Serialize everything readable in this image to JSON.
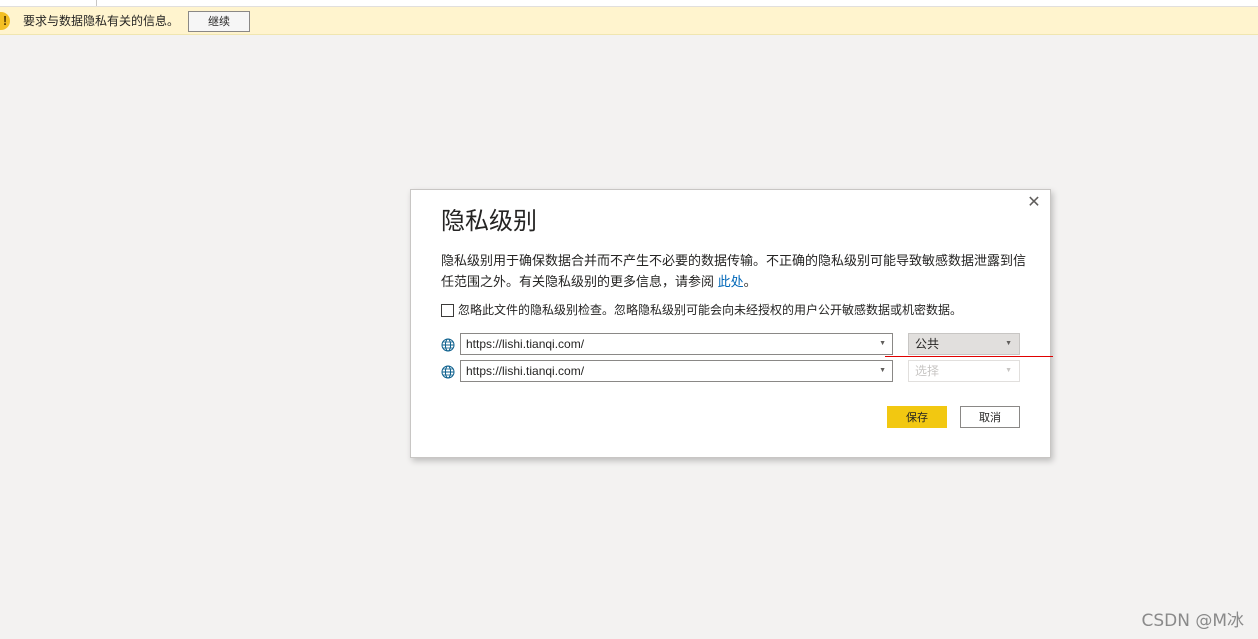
{
  "banner": {
    "icon": "warning-icon",
    "icon_glyph": "!",
    "message": "要求与数据隐私有关的信息。",
    "continue_label": "继续"
  },
  "dialog": {
    "title": "隐私级别",
    "close_glyph": "✕",
    "description": "隐私级别用于确保数据合并而不产生不必要的数据传输。不正确的隐私级别可能导致敏感数据泄露到信任范围之外。有关隐私级别的更多信息，请参阅",
    "link_text": "此处",
    "description_end": "。",
    "ignore_checkbox_label": "忽略此文件的隐私级别检查。忽略隐私级别可能会向未经授权的用户公开敏感数据或机密数据。",
    "ignore_checked": false,
    "sources": [
      {
        "icon": "globe-icon",
        "url": "https://lishi.tianqi.com/",
        "level": "公共",
        "level_is_placeholder": false
      },
      {
        "icon": "globe-icon",
        "url": "https://lishi.tianqi.com/",
        "level": "选择",
        "level_is_placeholder": true
      }
    ],
    "save_label": "保存",
    "cancel_label": "取消"
  },
  "watermark": "CSDN @M冰",
  "colors": {
    "banner_bg": "#fff4ce",
    "save_bg": "#f2c811",
    "link": "#0067b8",
    "annotation_line": "#e00000"
  }
}
